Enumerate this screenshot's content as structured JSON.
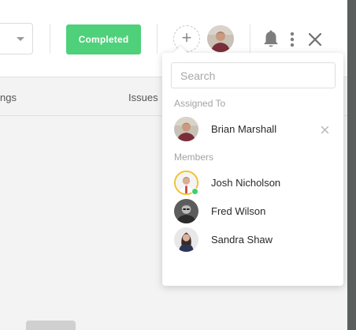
{
  "header": {
    "status_label": "Completed",
    "add_member_symbol": "+"
  },
  "tabs": [
    {
      "label": "ngs"
    },
    {
      "label": "Issues"
    }
  ],
  "dropdown": {
    "search_placeholder": "Search",
    "assigned_heading": "Assigned To",
    "assigned": [
      {
        "name": "Brian Marshall"
      }
    ],
    "members_heading": "Members",
    "members": [
      {
        "name": "Josh Nicholson",
        "online": true
      },
      {
        "name": "Fred Wilson"
      },
      {
        "name": "Sandra Shaw"
      }
    ]
  },
  "colors": {
    "status_green": "#4fd07a",
    "online_green": "#3fcf6e",
    "highlight_ring": "#f3c22b"
  },
  "icons": [
    "chevron-down-icon",
    "plus-icon",
    "bell-icon",
    "more-vertical-icon",
    "close-icon",
    "remove-icon"
  ]
}
